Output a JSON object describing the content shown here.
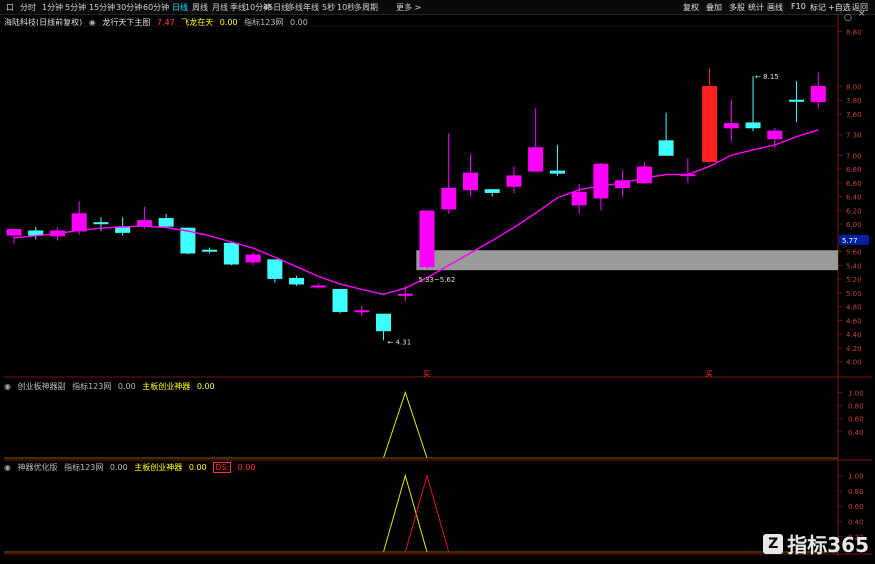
{
  "toolbar": {
    "left_items": [
      "口",
      "分时",
      "1分钟",
      "5分钟",
      "15分钟",
      "30分钟",
      "60分钟",
      "日线",
      "周线",
      "月线",
      "季线",
      "10分钟",
      "45日线",
      "多线",
      "年线",
      "5秒",
      "10秒",
      "多周期",
      "更多 >"
    ],
    "active_index": 7,
    "right_items": [
      "复权",
      "叠加",
      "多股",
      "统计",
      "画线",
      "F10",
      "标记",
      "+自选",
      "返回"
    ]
  },
  "main_info": {
    "stock": "海陆科技(日线前复权)",
    "indicator": "龙行天下主图",
    "value1": "7.47",
    "signal_label": "飞龙在天",
    "value2": "0.00",
    "ref_label": "指标123网",
    "value3": "0.00"
  },
  "panel2_info": {
    "name": "创业板神器副",
    "ref": "指标123网",
    "value1": "0.00",
    "label": "主板创业神器",
    "value2": "0.00"
  },
  "panel3_info": {
    "name": "神器优化版",
    "ref": "指标123网",
    "value1": "0.00",
    "label": "主板创业神器",
    "value2": "0.00",
    "tag": "DS:",
    "value3": "0.00"
  },
  "price_badge": "5.77",
  "annotations": {
    "low_label": "4.31",
    "high_label": "8.15",
    "zone_label": "5.33~5.62",
    "buy_signal_1": "买",
    "buy_signal_2": "买"
  },
  "logo": {
    "mark": "Z",
    "text": "指标365"
  },
  "colors": {
    "up": "#ff00ff",
    "down": "#40ffff",
    "red": "#ff2020",
    "ma": "#ff00ff",
    "zone": "#9a9a9a",
    "osc_yellow": "#e6e600",
    "osc_red": "#d01818",
    "grid": "#7a1010"
  },
  "chart_data": [
    {
      "type": "candlestick",
      "ylim": [
        3.85,
        8.85
      ],
      "yticks": [
        "8.80",
        "8.00",
        "7.80",
        "7.60",
        "7.30",
        "7.00",
        "6.80",
        "6.60",
        "6.40",
        "6.20",
        "6.00",
        "5.80",
        "5.60",
        "5.40",
        "5.20",
        "5.00",
        "4.80",
        "4.60",
        "4.40",
        "4.20",
        "4.00"
      ],
      "candles": [
        {
          "o": 5.84,
          "h": 5.93,
          "l": 5.72,
          "c": 5.92
        },
        {
          "o": 5.9,
          "h": 5.96,
          "l": 5.78,
          "c": 5.84
        },
        {
          "o": 5.83,
          "h": 5.95,
          "l": 5.76,
          "c": 5.9
        },
        {
          "o": 5.9,
          "h": 6.33,
          "l": 5.85,
          "c": 6.15
        },
        {
          "o": 6.02,
          "h": 6.1,
          "l": 5.9,
          "c": 6.02
        },
        {
          "o": 5.96,
          "h": 6.1,
          "l": 5.83,
          "c": 5.88
        },
        {
          "o": 5.98,
          "h": 6.25,
          "l": 5.93,
          "c": 6.05
        },
        {
          "o": 6.08,
          "h": 6.15,
          "l": 5.94,
          "c": 5.97
        },
        {
          "o": 5.94,
          "h": 5.95,
          "l": 5.56,
          "c": 5.58
        },
        {
          "o": 5.62,
          "h": 5.66,
          "l": 5.57,
          "c": 5.62
        },
        {
          "o": 5.72,
          "h": 5.74,
          "l": 5.4,
          "c": 5.42
        },
        {
          "o": 5.45,
          "h": 5.6,
          "l": 5.4,
          "c": 5.55
        },
        {
          "o": 5.48,
          "h": 5.48,
          "l": 5.15,
          "c": 5.21
        },
        {
          "o": 5.21,
          "h": 5.25,
          "l": 5.1,
          "c": 5.13
        },
        {
          "o": 5.1,
          "h": 5.14,
          "l": 5.06,
          "c": 5.1
        },
        {
          "o": 5.05,
          "h": 5.05,
          "l": 4.7,
          "c": 4.73
        },
        {
          "o": 4.74,
          "h": 4.81,
          "l": 4.66,
          "c": 4.74
        },
        {
          "o": 4.69,
          "h": 4.69,
          "l": 4.31,
          "c": 4.45
        },
        {
          "o": 4.98,
          "h": 5.1,
          "l": 4.88,
          "c": 4.98
        },
        {
          "o": 5.38,
          "h": 6.19,
          "l": 5.35,
          "c": 6.19
        },
        {
          "o": 6.22,
          "h": 7.32,
          "l": 6.15,
          "c": 6.52
        },
        {
          "o": 6.5,
          "h": 7.01,
          "l": 6.4,
          "c": 6.74
        },
        {
          "o": 6.5,
          "h": 6.5,
          "l": 6.4,
          "c": 6.46
        },
        {
          "o": 6.7,
          "h": 6.84,
          "l": 6.45,
          "c": 6.55
        },
        {
          "o": 6.77,
          "h": 7.69,
          "l": 6.75,
          "c": 7.11
        },
        {
          "o": 6.77,
          "h": 7.15,
          "l": 6.7,
          "c": 6.74
        },
        {
          "o": 6.46,
          "h": 6.58,
          "l": 6.15,
          "c": 6.28
        },
        {
          "o": 6.38,
          "h": 6.89,
          "l": 6.2,
          "c": 6.87
        },
        {
          "o": 6.53,
          "h": 6.78,
          "l": 6.4,
          "c": 6.63
        },
        {
          "o": 6.6,
          "h": 6.9,
          "l": 6.58,
          "c": 6.83
        },
        {
          "o": 7.21,
          "h": 7.62,
          "l": 7.0,
          "c": 7.0
        },
        {
          "o": 6.72,
          "h": 6.96,
          "l": 6.6,
          "c": 6.72
        },
        {
          "o": 6.91,
          "h": 8.26,
          "l": 6.88,
          "c": 8.0
        },
        {
          "o": 7.46,
          "h": 7.81,
          "l": 7.2,
          "c": 7.4
        },
        {
          "o": 7.47,
          "h": 8.15,
          "l": 7.35,
          "c": 7.4
        },
        {
          "o": 7.24,
          "h": 7.4,
          "l": 7.1,
          "c": 7.35
        },
        {
          "o": 7.8,
          "h": 8.08,
          "l": 7.48,
          "c": 7.8
        },
        {
          "o": 7.78,
          "h": 8.2,
          "l": 7.68,
          "c": 8.0
        }
      ],
      "candle_colors": [
        "up",
        "down",
        "up",
        "up",
        "down",
        "down",
        "up",
        "down",
        "down",
        "down",
        "down",
        "up",
        "down",
        "down",
        "up",
        "down",
        "up",
        "down",
        "up",
        "up",
        "up",
        "up",
        "down",
        "up",
        "up",
        "down",
        "up",
        "up",
        "up",
        "up",
        "down",
        "up",
        "red",
        "up",
        "down",
        "up",
        "down",
        "up"
      ],
      "ma_line": [
        5.8,
        5.83,
        5.86,
        5.91,
        5.94,
        5.96,
        5.97,
        5.95,
        5.9,
        5.83,
        5.74,
        5.65,
        5.52,
        5.38,
        5.24,
        5.13,
        5.05,
        4.98,
        5.07,
        5.22,
        5.4,
        5.58,
        5.76,
        5.95,
        6.16,
        6.38,
        6.5,
        6.55,
        6.6,
        6.67,
        6.72,
        6.72,
        6.84,
        7.0,
        7.08,
        7.15,
        7.27,
        7.37
      ],
      "zone": {
        "x_start": 18.6,
        "x_end": 40,
        "low": 5.33,
        "high": 5.62
      }
    },
    {
      "type": "line",
      "ylim": [
        0,
        1.1
      ],
      "yticks": [
        "1.00",
        "0.80",
        "0.60",
        "0.40"
      ],
      "series": [
        {
          "values": [
            0,
            0,
            0,
            0,
            0,
            0,
            0,
            0,
            0,
            0,
            0,
            0,
            0,
            0,
            0,
            0,
            0,
            0.0,
            1.0,
            0,
            0,
            0,
            0,
            0,
            0,
            0,
            0,
            0,
            0,
            0,
            0,
            0,
            0,
            0,
            0,
            0,
            0,
            0
          ]
        }
      ]
    },
    {
      "type": "line",
      "ylim": [
        0,
        1.1
      ],
      "yticks": [
        "1.00",
        "0.80",
        "0.60",
        "0.40",
        "0.20"
      ],
      "series": [
        {
          "values": [
            0,
            0,
            0,
            0,
            0,
            0,
            0,
            0,
            0,
            0,
            0,
            0,
            0,
            0,
            0,
            0,
            0,
            0.0,
            1.0,
            0,
            0,
            0,
            0,
            0,
            0,
            0,
            0,
            0,
            0,
            0,
            0,
            0,
            0,
            0,
            0,
            0,
            0,
            0
          ]
        },
        {
          "values": [
            0,
            0,
            0,
            0,
            0,
            0,
            0,
            0,
            0,
            0,
            0,
            0,
            0,
            0,
            0,
            0,
            0,
            0,
            0.0,
            1.0,
            0,
            0,
            0,
            0,
            0,
            0,
            0,
            0,
            0,
            0,
            0,
            0,
            0,
            0,
            0,
            0,
            0,
            0
          ]
        }
      ]
    }
  ]
}
